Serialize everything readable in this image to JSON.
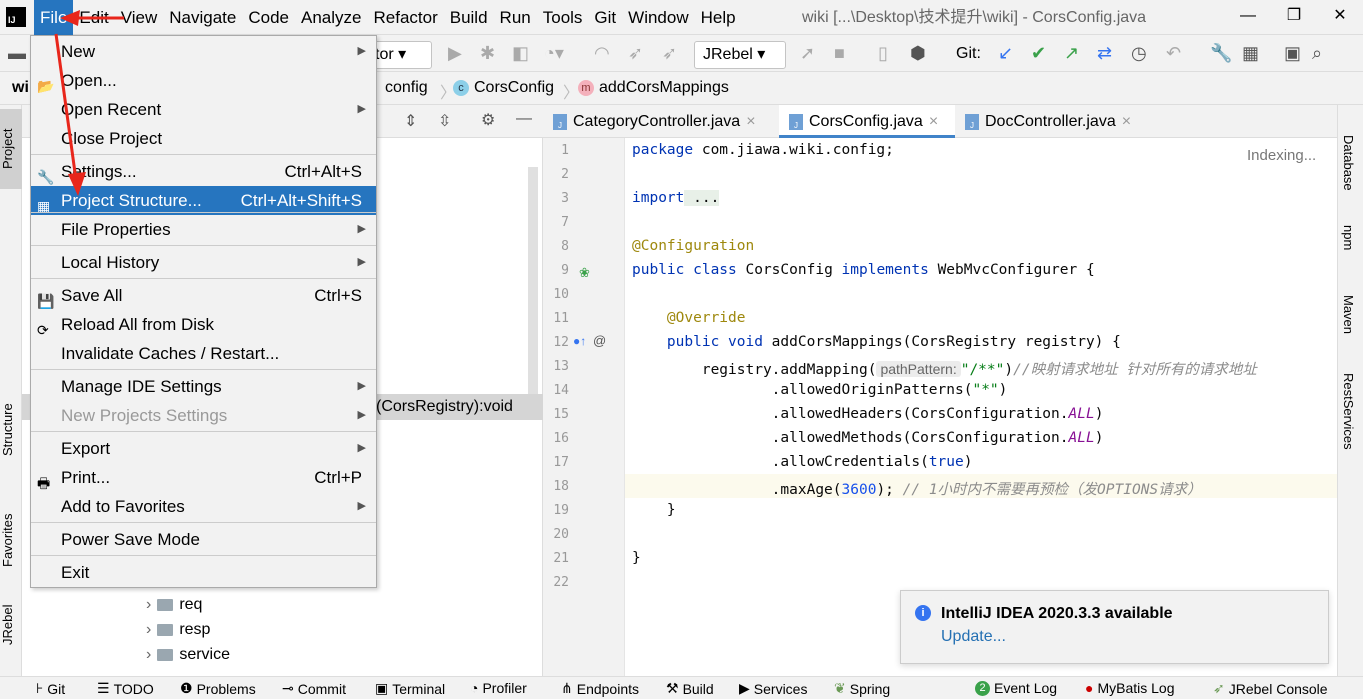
{
  "menubar": {
    "items": [
      "File",
      "Edit",
      "View",
      "Navigate",
      "Code",
      "Analyze",
      "Refactor",
      "Build",
      "Run",
      "Tools",
      "Git",
      "Window",
      "Help"
    ],
    "window_title": "wiki [...\\Desktop\\技术提升\\wiki] - CorsConfig.java",
    "logo": "IJ"
  },
  "toolbar": {
    "run_config": "tor",
    "jrebel": "JRebel",
    "git_label": "Git:"
  },
  "breadcrumb": {
    "project": "wi",
    "items": [
      "config",
      "CorsConfig",
      "addCorsMappings"
    ]
  },
  "file_menu": {
    "items": [
      {
        "label": "New",
        "arrow": true
      },
      {
        "label": "Open...",
        "icon": "folder-icon"
      },
      {
        "label": "Open Recent",
        "arrow": true
      },
      {
        "label": "Close Project"
      },
      {
        "label": "Settings...",
        "shortcut": "Ctrl+Alt+S",
        "icon": "wrench-icon"
      },
      {
        "label": "Project Structure...",
        "shortcut": "Ctrl+Alt+Shift+S",
        "selected": true,
        "icon": "project-structure-icon"
      },
      {
        "label": "File Properties",
        "arrow": true
      },
      {
        "label": "Local History",
        "arrow": true
      },
      {
        "label": "Save All",
        "shortcut": "Ctrl+S",
        "icon": "save-icon"
      },
      {
        "label": "Reload All from Disk",
        "icon": "reload-icon"
      },
      {
        "label": "Invalidate Caches / Restart..."
      },
      {
        "label": "Manage IDE Settings",
        "arrow": true
      },
      {
        "label": "New Projects Settings",
        "arrow": true,
        "disabled": true
      },
      {
        "label": "Export",
        "arrow": true
      },
      {
        "label": "Print...",
        "shortcut": "Ctrl+P",
        "icon": "print-icon"
      },
      {
        "label": "Add to Favorites",
        "arrow": true
      },
      {
        "label": "Power Save Mode"
      },
      {
        "label": "Exit"
      }
    ]
  },
  "project": {
    "selected_row": "(CorsRegistry):void",
    "tree": [
      "req",
      "resp",
      "service"
    ]
  },
  "left_stripe": [
    "Project",
    "Structure",
    "Favorites",
    "JRebel"
  ],
  "right_stripe": [
    "Database",
    "npm",
    "Maven",
    "RestServices"
  ],
  "editor": {
    "tabs": [
      {
        "label": "CategoryController.java"
      },
      {
        "label": "CorsConfig.java",
        "active": true
      },
      {
        "label": "DocController.java"
      }
    ],
    "status": "Indexing...",
    "param_hint": "pathPattern:",
    "lines": [
      "1",
      "2",
      "3",
      "7",
      "8",
      "9",
      "10",
      "11",
      "12",
      "13",
      "14",
      "15",
      "16",
      "17",
      "18",
      "19",
      "20",
      "21",
      "22"
    ],
    "code": {
      "l1a": "package",
      "l1b": " com.jiawa.wiki.config;",
      "l3a": "import",
      "l3b": " ...",
      "l8": "@Configuration",
      "l9a": "public class",
      "l9b": " CorsConfig ",
      "l9c": "implements",
      "l9d": " WebMvcConfigurer {",
      "l11": "    @Override",
      "l12a": "    public void",
      "l12b": " addCorsMappings(CorsRegistry registry) {",
      "l13a": "        registry.addMapping(",
      "l13b": "\"/**\"",
      "l13c": ")",
      "l13d": "//映射请求地址 针对所有的请求地址",
      "l14a": "                .allowedOriginPatterns(",
      "l14b": "\"*\"",
      "l14c": ")",
      "l15a": "                .allowedHeaders(CorsConfiguration.",
      "l15b": "ALL",
      "l15c": ")",
      "l16a": "                .allowedMethods(CorsConfiguration.",
      "l16b": "ALL",
      "l16c": ")",
      "l17a": "                .allowCredentials(",
      "l17b": "true",
      "l17c": ")",
      "l18a": "                .maxAge(",
      "l18b": "3600",
      "l18c": "); ",
      "l18d": "// 1小时内不需要再预检（发OPTIONS请求）",
      "l19": "    }",
      "l21": "}"
    }
  },
  "notification": {
    "title": "IntelliJ IDEA 2020.3.3 available",
    "link": "Update..."
  },
  "bottombar": {
    "items": [
      "Git",
      "TODO",
      "Problems",
      "Commit",
      "Terminal",
      "Profiler",
      "Endpoints",
      "Build",
      "Services",
      "Spring"
    ],
    "event_log_count": "2",
    "event_log": "Event Log",
    "mybatis": "MyBatis Log",
    "jrebel": "JRebel Console"
  },
  "colors": {
    "accent": "#2675bf",
    "annotation_arrow": "#e8261b"
  }
}
